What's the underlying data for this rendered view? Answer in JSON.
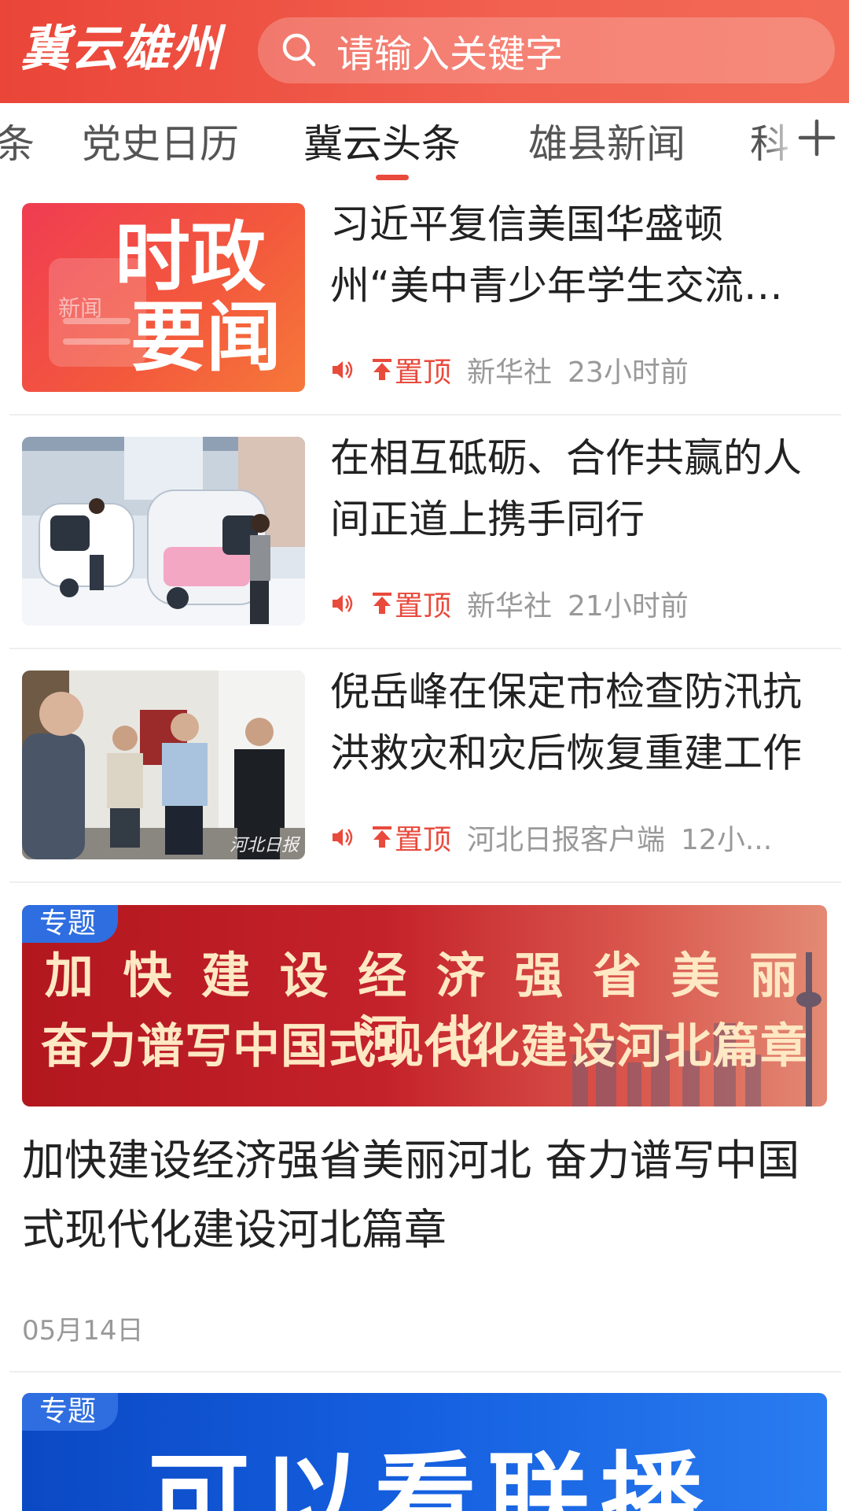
{
  "header": {
    "logo": "冀云雄州",
    "search_placeholder": "请输入关键字",
    "background": "#ea4538"
  },
  "tabs": {
    "items": [
      {
        "label": "条"
      },
      {
        "label": "党史日历"
      },
      {
        "label": "冀云头条"
      },
      {
        "label": "雄县新闻"
      },
      {
        "label": "科"
      }
    ],
    "active_index": 2
  },
  "news": [
    {
      "title": "习近平复信美国华盛顿州“美中青少年学生交流协会”",
      "pinned_label": "置顶",
      "source": "新华社",
      "time": "23小时前",
      "thumb": {
        "type": "graphic",
        "line1": "时政",
        "line2": "要闻",
        "watermark": "新闻"
      }
    },
    {
      "title": "在相互砥砺、合作共赢的人间正道上携手同行",
      "pinned_label": "置顶",
      "source": "新华社",
      "time": "21小时前",
      "thumb": {
        "type": "photo"
      }
    },
    {
      "title": "倪岳峰在保定市检查防汛抗洪救灾和灾后恢复重建工作",
      "pinned_label": "置顶",
      "source": "河北日报客户端",
      "time": "12小...",
      "thumb": {
        "type": "photo",
        "watermark": "河北日报"
      }
    }
  ],
  "topics": [
    {
      "tag": "专题",
      "banner_line1": "加 快 建 设 经 济 强 省 美 丽 河 北",
      "banner_line2": "奋力谱写中国式现代化建设河北篇章",
      "title": "加快建设经济强省美丽河北 奋力谱写中国式现代化建设河北篇章",
      "date": "05月14日"
    },
    {
      "tag": "专题",
      "banner_text": "可以看联播"
    }
  ],
  "colors": {
    "accent": "#e84a3c",
    "topic_tag": "#2f6ee0"
  }
}
